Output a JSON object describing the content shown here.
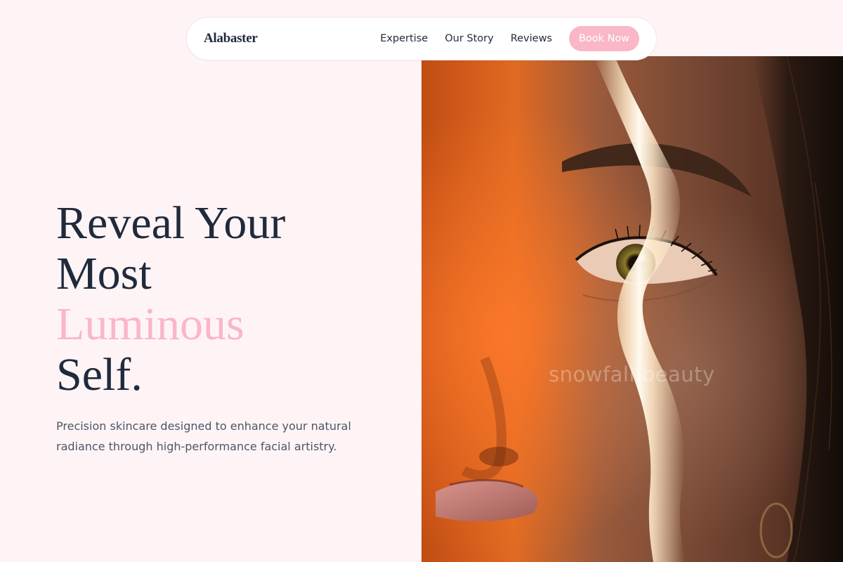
{
  "nav": {
    "brand": "Alabaster",
    "links": [
      "Expertise",
      "Our Story",
      "Reviews"
    ],
    "cta": "Book Now"
  },
  "hero": {
    "title_lines": [
      "Reveal Your",
      "Most",
      "Luminous",
      "Self."
    ],
    "subtitle": "Precision skincare designed to enhance your natural radiance through high-performance facial artistry.",
    "image_watermark": "snowfall.beauty"
  },
  "colors": {
    "background": "#fff4f5",
    "text_dark": "#1f2a3d",
    "accent_pink": "#f9b7c8",
    "subtitle_gray": "#4d5568"
  }
}
